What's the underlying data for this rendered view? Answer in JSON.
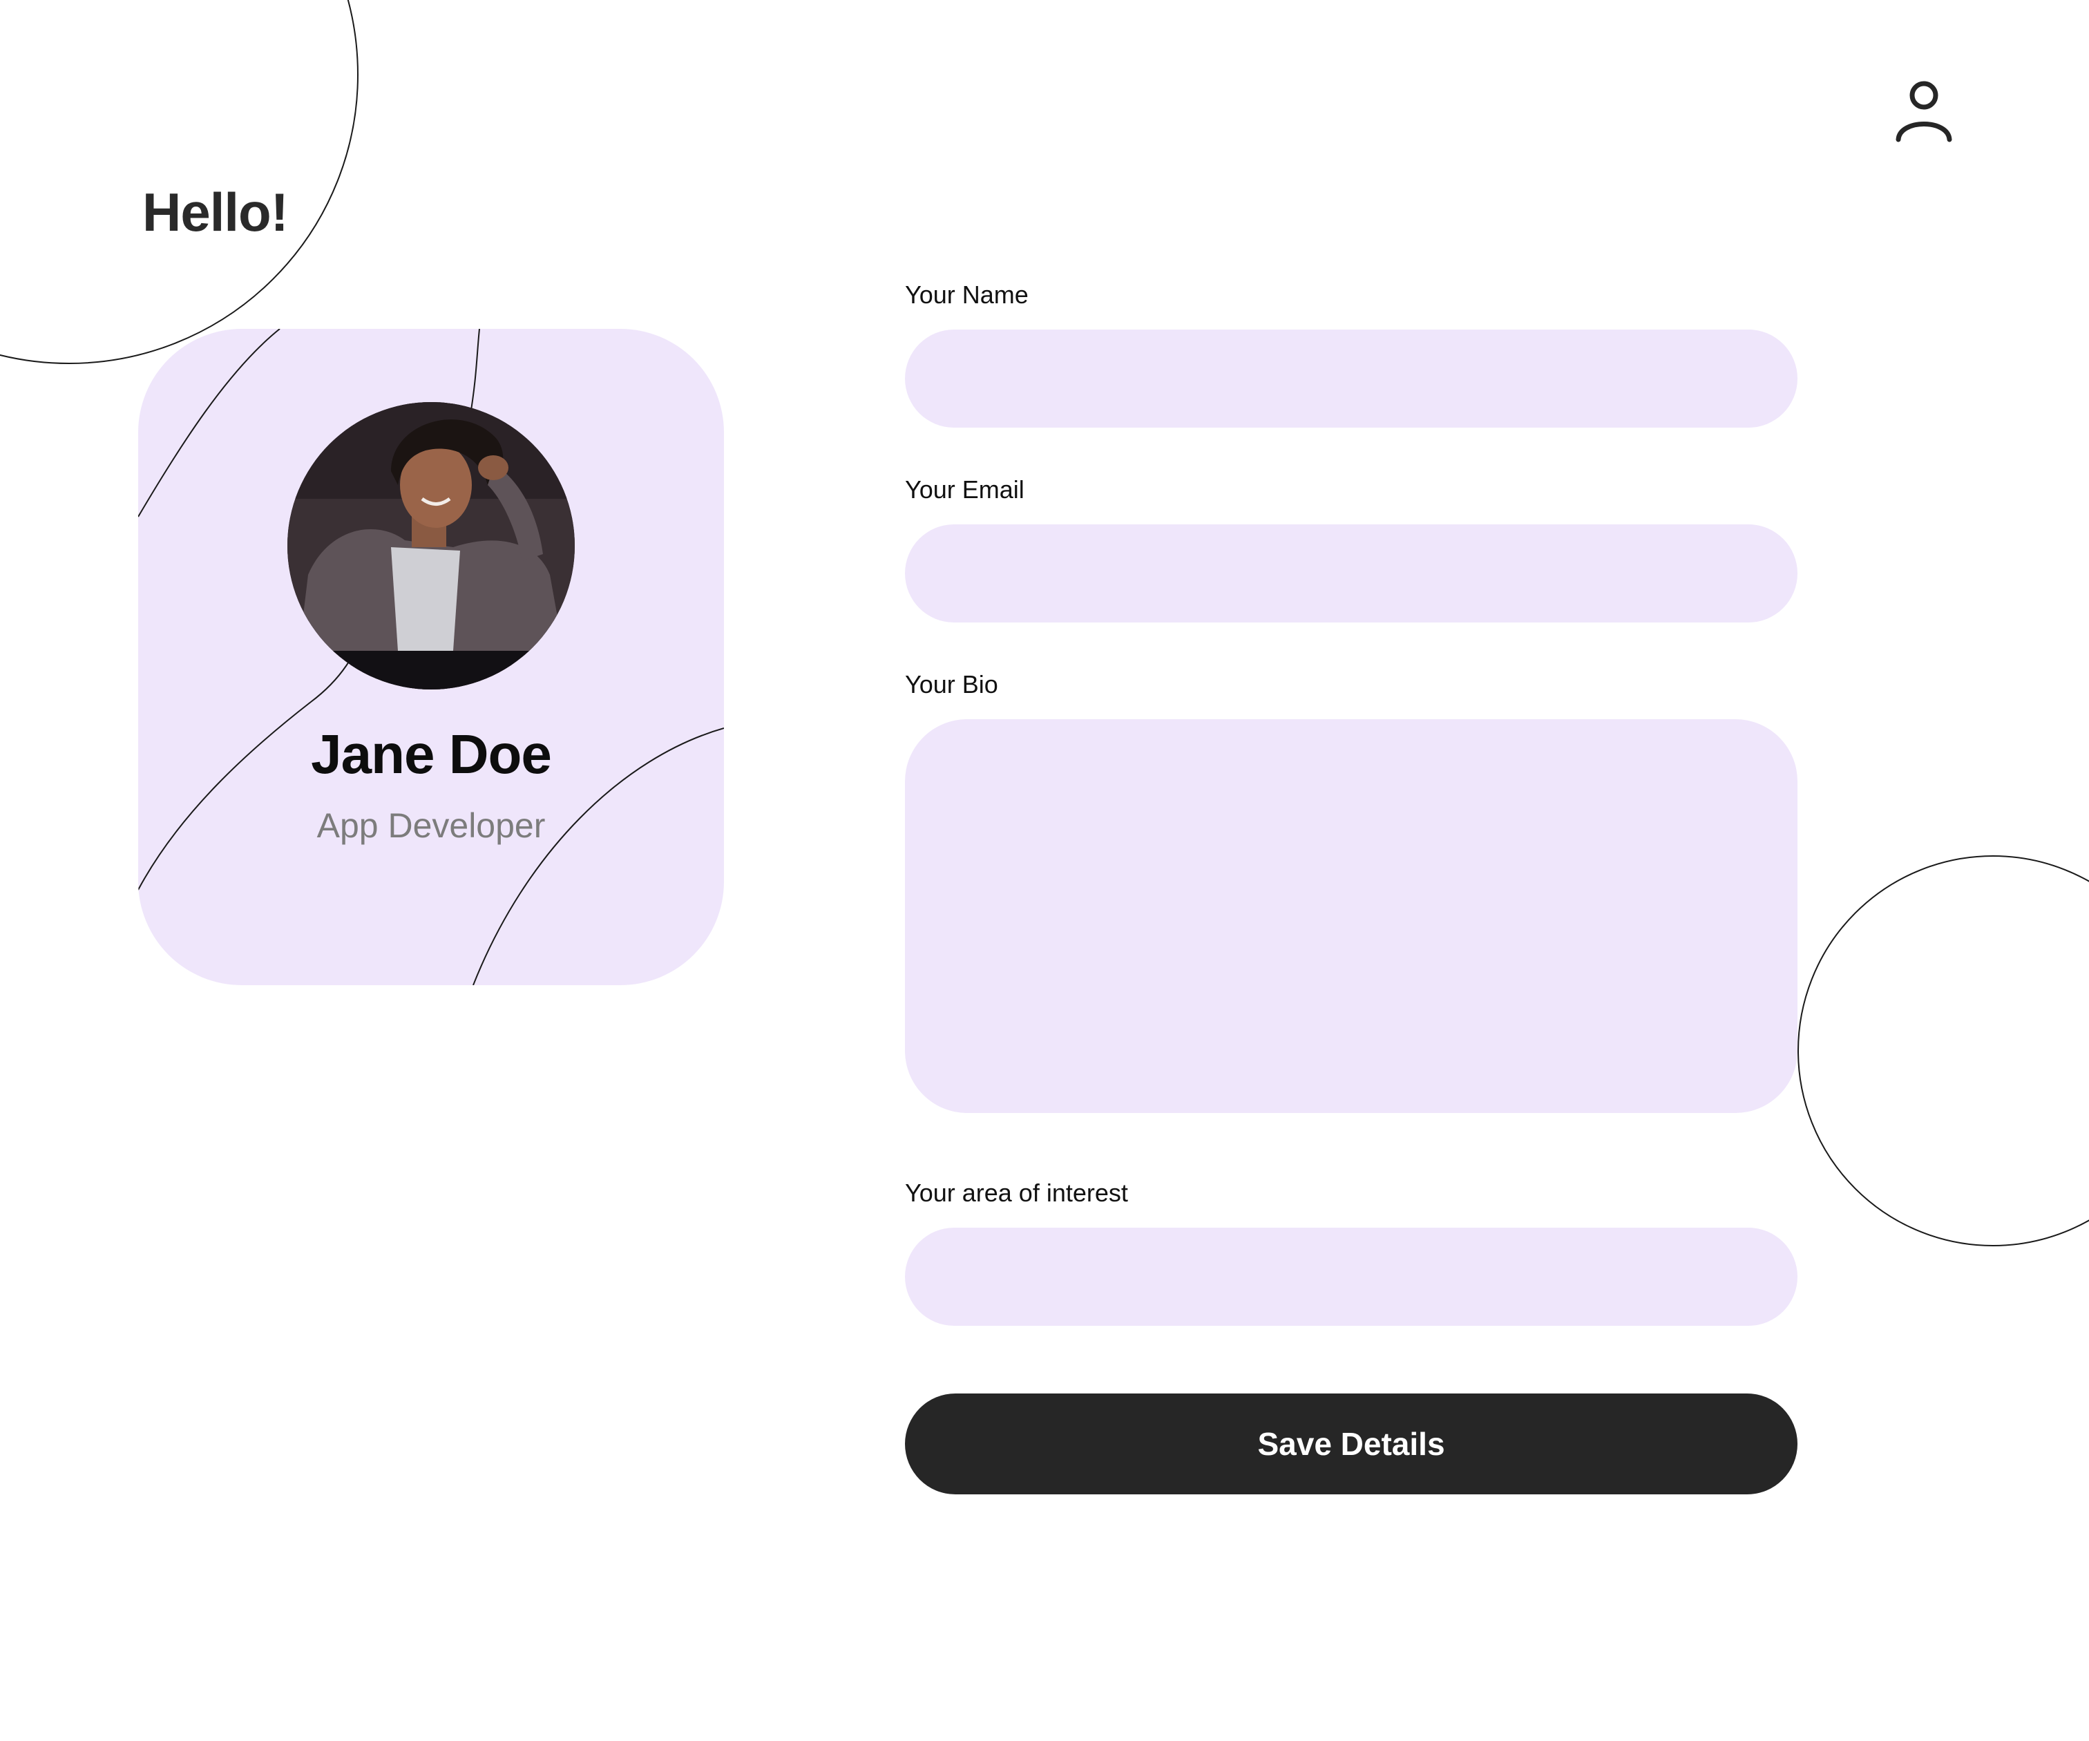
{
  "greeting": "Hello!",
  "header": {
    "profile_icon": "user-icon"
  },
  "profile_card": {
    "name": "Jane Doe",
    "role": "App Developer",
    "avatar_alt": "profile-photo"
  },
  "form": {
    "name_label": "Your Name",
    "name_value": "",
    "email_label": "Your Email",
    "email_value": "",
    "bio_label": "Your Bio",
    "bio_value": "",
    "interest_label": "Your area of interest",
    "interest_value": "",
    "save_label": "Save Details"
  },
  "colors": {
    "accent_fill": "#efe6fb",
    "button_bg": "#262626",
    "button_text": "#ffffff",
    "muted_text": "#7c7c7c"
  }
}
